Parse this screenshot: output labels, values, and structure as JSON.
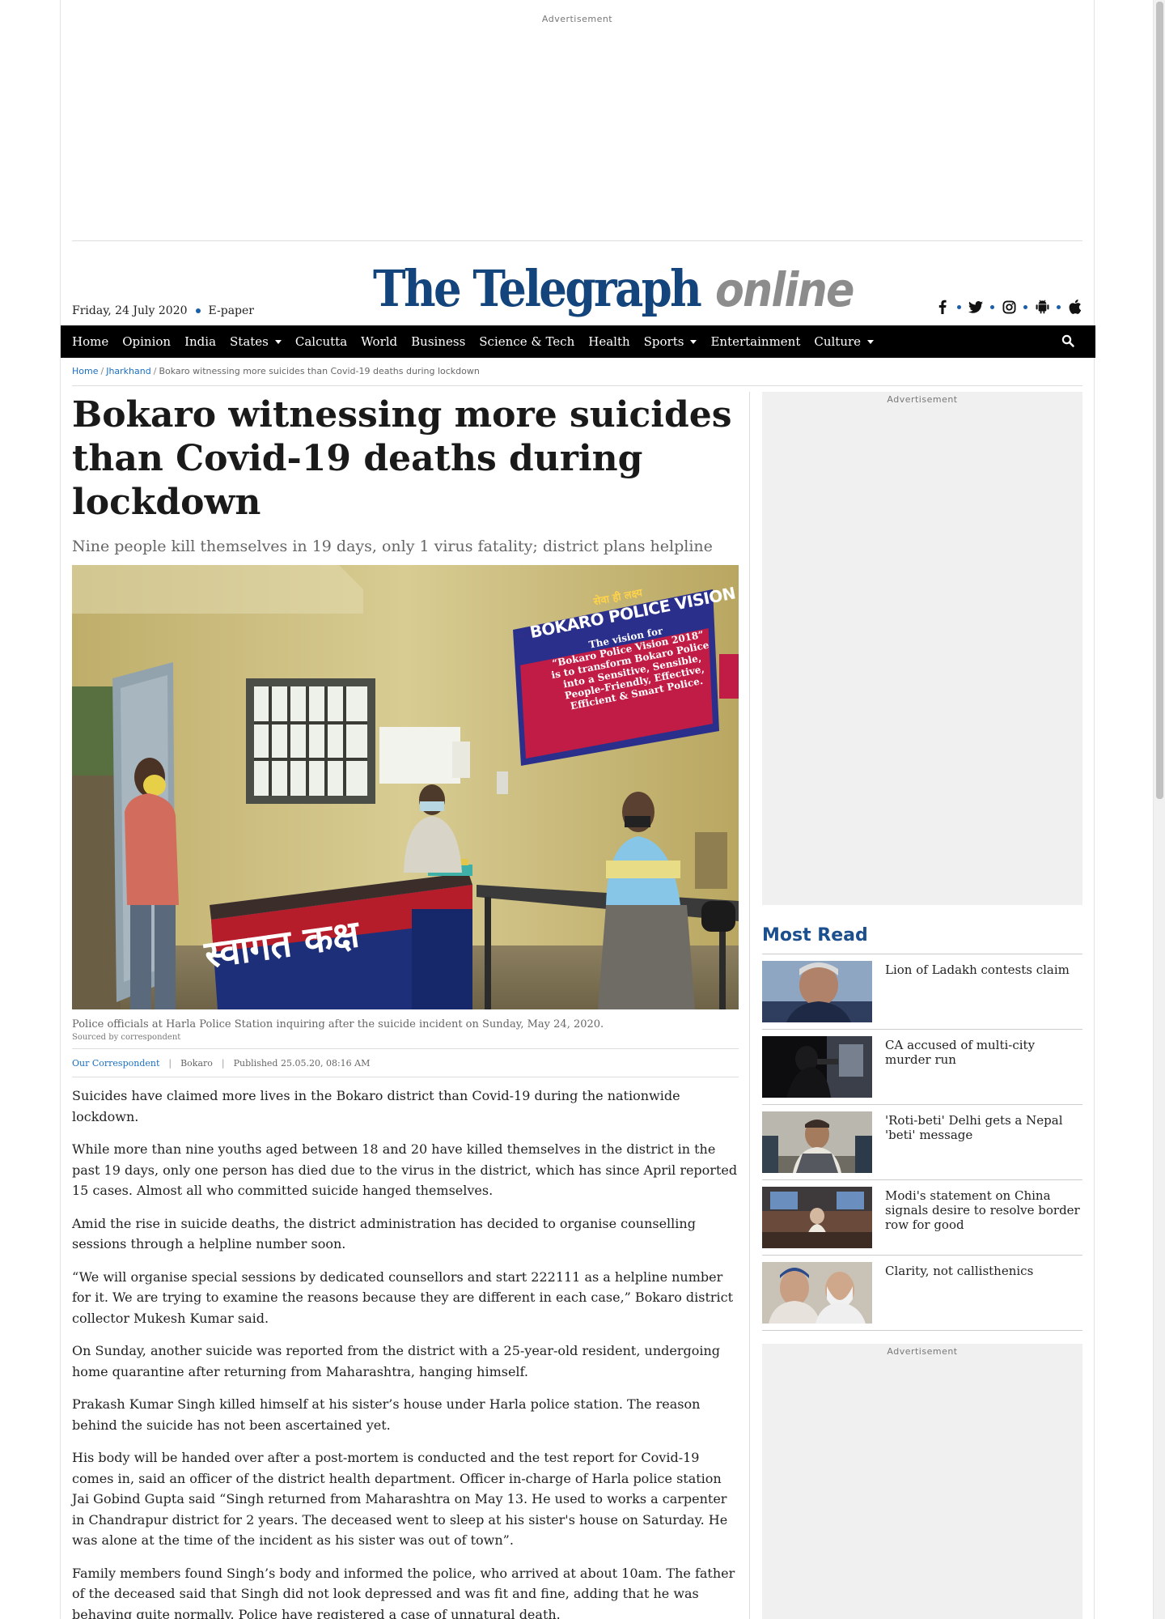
{
  "ads": {
    "label": "Advertisement"
  },
  "masthead": {
    "date": "Friday, 24 July 2020",
    "epaper": "E-paper",
    "logo_main": "The Telegraph",
    "logo_online": "online",
    "social_icons": [
      "facebook-icon",
      "twitter-icon",
      "instagram-icon",
      "android-icon",
      "apple-icon"
    ]
  },
  "nav": {
    "items": [
      {
        "label": "Home",
        "dropdown": false
      },
      {
        "label": "Opinion",
        "dropdown": false
      },
      {
        "label": "India",
        "dropdown": false
      },
      {
        "label": "States",
        "dropdown": true
      },
      {
        "label": "Calcutta",
        "dropdown": false
      },
      {
        "label": "World",
        "dropdown": false
      },
      {
        "label": "Business",
        "dropdown": false
      },
      {
        "label": "Science & Tech",
        "dropdown": false
      },
      {
        "label": "Health",
        "dropdown": false
      },
      {
        "label": "Sports",
        "dropdown": true
      },
      {
        "label": "Entertainment",
        "dropdown": false
      },
      {
        "label": "Culture",
        "dropdown": true
      }
    ],
    "search_icon": "search-icon"
  },
  "breadcrumb": {
    "home": "Home",
    "section": "Jharkhand",
    "current": "Bokaro witnessing more suicides than Covid-19 deaths during lockdown"
  },
  "article": {
    "headline": "Bokaro witnessing more suicides than Covid-19 deaths during lockdown",
    "standfirst": "Nine people kill themselves in 19 days, only 1 virus fatality; district plans helpline",
    "image_banner": {
      "line1": "सेवा ही लक्ष्य",
      "line2": "BOKARO POLICE VISION 2018",
      "line3": "The vision for",
      "line4": "“Bokaro Police Vision 2018”",
      "line5": "is to transform Bokaro Police",
      "line6": "into a Sensitive, Sensible,",
      "line7": "People-Friendly, Effective,",
      "line8": "Efficient & Smart Police."
    },
    "image_desk_text": "स्वागत कक्ष",
    "caption": "Police officials at Harla Police Station inquiring after the suicide incident on Sunday, May 24, 2020.",
    "credit": "Sourced by correspondent",
    "byline": {
      "author": "Our Correspondent",
      "location": "Bokaro",
      "published": "Published 25.05.20, 08:16 AM"
    },
    "paragraphs": [
      "Suicides have claimed more lives in the Bokaro district than Covid-19 during the nationwide lockdown.",
      "While more than nine youths aged between 18 and 20 have killed themselves in the district in the past 19 days, only one person has died due to the virus in the district, which has since April reported 15 cases. Almost all who committed suicide hanged themselves.",
      "Amid the rise in suicide deaths, the district administration has decided to organise counselling sessions through a helpline number soon.",
      "“We will organise special sessions by dedicated counsellors and start 222111 as a helpline number for it. We are trying to examine the reasons because they are different in each case,” Bokaro district collector Mukesh Kumar said.",
      "On Sunday, another suicide was reported from the district with a 25-year-old resident, undergoing home quarantine after returning from Maharashtra, hanging himself.",
      "Prakash Kumar Singh killed himself at his sister’s house under Harla police station. The reason behind the suicide has not been ascertained yet.",
      "His body will be handed over after a post-mortem is conducted and the test report for Covid-19 comes in, said an officer of the district health department. Officer in-charge of Harla police station Jai Gobind Gupta said “Singh returned from Maharashtra on May 13. He used to works a carpenter in Chandrapur district for 2 years. The deceased went to sleep at his sister's house on Saturday. He was alone at the time of the incident as his sister was out of town”.",
      "Family members found Singh’s body and informed the police, who arrived at about 10am. The father of the deceased said that Singh did not look depressed and was fit and fine, adding that he was behaving quite normally. Police have registered a case of unnatural death."
    ]
  },
  "most_read": {
    "title": "Most Read",
    "items": [
      {
        "title": "Lion of Ladakh contests claim"
      },
      {
        "title": "CA accused of multi-city murder run"
      },
      {
        "title": "'Roti-beti' Delhi gets a Nepal 'beti' message"
      },
      {
        "title": "Modi's statement on China signals desire to resolve border row for good"
      },
      {
        "title": "Clarity, not callisthenics"
      }
    ]
  },
  "colors": {
    "brand_blue": "#13447c",
    "link_blue": "#1b6fc1",
    "nav_bg": "#000000",
    "ad_bg": "#f0f0f0"
  }
}
